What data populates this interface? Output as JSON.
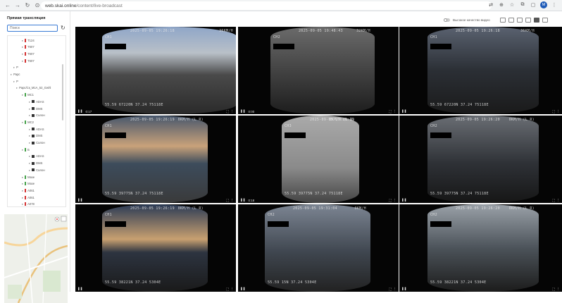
{
  "browser": {
    "url_domain": "web.skai.online",
    "url_path": "/content/live-broadcast",
    "avatar_letter": "M"
  },
  "sidebar": {
    "title": "Прямая трансляция",
    "search_placeholder": "Поиск",
    "tree": [
      {
        "label": "Т124",
        "flag": "#d32f2f",
        "indent": 30,
        "check": false
      },
      {
        "label": "Т607",
        "flag": "#d32f2f",
        "indent": 30,
        "check": false
      },
      {
        "label": "Т607",
        "flag": "#d32f2f",
        "indent": 30,
        "check": false
      },
      {
        "label": "Т607",
        "flag": "#d32f2f",
        "indent": 30,
        "check": false
      },
      {
        "label": "Р",
        "flag": "",
        "indent": 18,
        "check": false
      },
      {
        "label": "Рарс",
        "flag": "",
        "indent": 14,
        "check": false
      },
      {
        "label": "Р",
        "flag": "",
        "indent": 18,
        "check": false
      },
      {
        "label": "Рарс/Ск_М1А_52_Gwhl",
        "flag": "",
        "indent": 22,
        "check": false
      },
      {
        "label": "МС1",
        "flag": "#43a047",
        "indent": 30,
        "check": false
      },
      {
        "label": "ADAS",
        "flag": "",
        "indent": 40,
        "check": true
      },
      {
        "label": "DMS",
        "flag": "",
        "indent": 40,
        "check": true
      },
      {
        "label": "Салон",
        "flag": "",
        "indent": 40,
        "check": true
      },
      {
        "label": "МС2",
        "flag": "#43a047",
        "indent": 30,
        "check": false
      },
      {
        "label": "ADAS",
        "flag": "",
        "indent": 40,
        "check": true
      },
      {
        "label": "DMS",
        "flag": "",
        "indent": 40,
        "check": true
      },
      {
        "label": "Салон",
        "flag": "",
        "indent": 40,
        "check": true
      },
      {
        "label": "Б",
        "flag": "#43a047",
        "indent": 30,
        "check": false
      },
      {
        "label": "ADAS",
        "flag": "",
        "indent": 40,
        "check": true
      },
      {
        "label": "DMS",
        "flag": "",
        "indent": 40,
        "check": true
      },
      {
        "label": "Салон",
        "flag": "",
        "indent": 40,
        "check": true
      },
      {
        "label": "Мазе",
        "flag": "#43a047",
        "indent": 30,
        "check": false
      },
      {
        "label": "Мазе",
        "flag": "#43a047",
        "indent": 30,
        "check": false
      },
      {
        "label": "А061",
        "flag": "#d32f2f",
        "indent": 30,
        "check": false
      },
      {
        "label": "А061",
        "flag": "#d32f2f",
        "indent": 30,
        "check": false
      },
      {
        "label": "А078",
        "flag": "#d32f2f",
        "indent": 30,
        "check": false
      }
    ]
  },
  "toolbar": {
    "hq_label": "Высокое качество видео"
  },
  "cameras": [
    {
      "ch": "CH1",
      "ts": "2025-09-05 19:26:18",
      "speed": "36KM/H",
      "coords": "55.59 67220N 37.24 75118E",
      "time": "0:17",
      "scene": "road-dusk"
    },
    {
      "ch": "CH2",
      "ts": "2025-09-05 19:48:43",
      "speed": "32KM/H",
      "coords": "",
      "time": "0:00",
      "scene": "cabin-two"
    },
    {
      "ch": "CH1",
      "ts": "2025-09-05 19:26:18",
      "speed": "36KM/H",
      "coords": "55.59 67220N 37.24 75118E",
      "time": "",
      "scene": "cabin-back"
    },
    {
      "ch": "CH1",
      "ts": "2025-09-05 19:26:19",
      "speed": "0KM/H (L R)",
      "coords": "55.59 39775N 37.24 75118E",
      "time": "",
      "scene": "yard-sunset"
    },
    {
      "ch": "CH3",
      "ts": "2025-09-05 19:26:19",
      "speed": "0KM/H (L R)",
      "coords": "55.59 39775N 37.24 75118E",
      "time": "0:18",
      "scene": "cargo-seat"
    },
    {
      "ch": "CH2",
      "ts": "2025-09-05 19:26:20",
      "speed": "0KM/H (L R)",
      "coords": "55.59 39775N 37.24 75118E",
      "time": "",
      "scene": "cabin-empty"
    },
    {
      "ch": "CH1",
      "ts": "2025-09-05 19:26:19",
      "speed": "0KM/H (L R)",
      "coords": "55.59 38221N 37.24 5304E",
      "time": "",
      "scene": "yard-dark"
    },
    {
      "ch": "CH2",
      "ts": "2025-09-05 19:31:04",
      "speed": "0KM/H",
      "coords": "55.59 15N 37.24 5304E",
      "time": "",
      "scene": "cabin-vest"
    },
    {
      "ch": "CH2",
      "ts": "2025-09-05 19:26:20",
      "speed": "0KM/H (L R)",
      "coords": "55.59 38221N 37.24 5304E",
      "time": "",
      "scene": "cabin-seats"
    }
  ]
}
